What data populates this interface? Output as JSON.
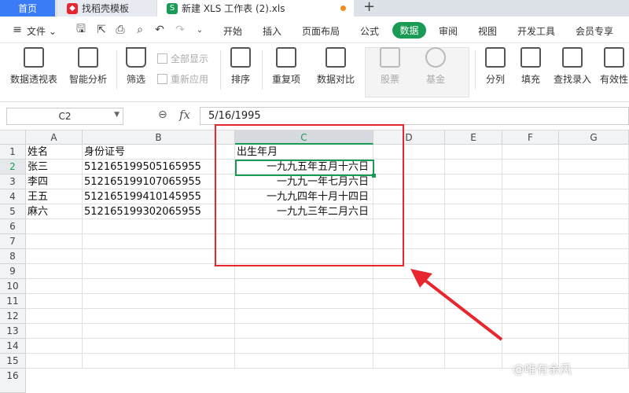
{
  "tabs": {
    "home": "首页",
    "template": "找稻壳模板",
    "file": "新建 XLS 工作表 (2).xls"
  },
  "menu": {
    "file": "文件",
    "items": [
      "开始",
      "插入",
      "页面布局",
      "公式",
      "数据",
      "审阅",
      "视图",
      "开发工具",
      "会员专享"
    ]
  },
  "ribbon": {
    "pivot": "数据透视表",
    "smart": "智能分析",
    "filter": "筛选",
    "show_all": "全部显示",
    "reapply": "重新应用",
    "sort": "排序",
    "dup": "重复项",
    "compare": "数据对比",
    "stock": "股票",
    "fund": "基金",
    "split": "分列",
    "fill": "填充",
    "find_entry": "查找录入",
    "validity": "有效性"
  },
  "formula_bar": {
    "cell_ref": "C2",
    "fx": "fx",
    "value": "5/16/1995"
  },
  "columns": [
    "A",
    "B",
    "C",
    "D",
    "E",
    "F",
    "G"
  ],
  "rows": [
    "1",
    "2",
    "3",
    "4",
    "5",
    "6",
    "7",
    "8",
    "9",
    "10",
    "11",
    "12",
    "13",
    "14",
    "15",
    "16"
  ],
  "sheet": [
    [
      "姓名",
      "身份证号",
      "出生年月"
    ],
    [
      "张三",
      "512165199505165955",
      "一九九五年五月十六日"
    ],
    [
      "李四",
      "512165199107065955",
      "一九九一年七月六日"
    ],
    [
      "王五",
      "512165199410145955",
      "一九九四年十月十四日"
    ],
    [
      "麻六",
      "512165199302065955",
      "一九九三年二月六日"
    ]
  ],
  "watermark": "@唯有余风",
  "colors": {
    "accent": "#1a9b55",
    "highlight": "#e8262d",
    "home_tab": "#3a7bf6"
  }
}
